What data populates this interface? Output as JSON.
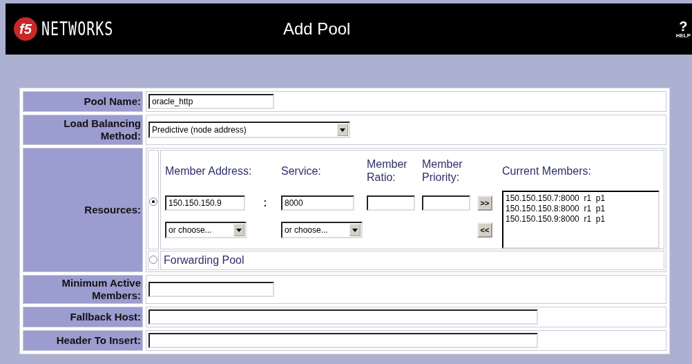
{
  "header": {
    "logo_mark": "f5",
    "logo_text": "NETWORKS",
    "title": "Add Pool",
    "help_mark": "?",
    "help_label": "HELP"
  },
  "rows": [
    {
      "kind": "text",
      "label": "Pool Name:",
      "value": "oracle_http"
    },
    {
      "kind": "select",
      "label": "Load Balancing Method:",
      "value": "Predictive (node address)"
    },
    {
      "kind": "resources",
      "label": "Resources:",
      "options": [
        {
          "kind": "members",
          "selected": true,
          "address_label": "Member Address:",
          "service_label": "Service:",
          "ratio_label": "Member Ratio:",
          "priority_label": "Member Priority:",
          "current_label": "Current Members:",
          "address": "150.150.150.9",
          "separator": ":",
          "service": "8000",
          "address_choose": "or choose...",
          "service_choose": "or choose...",
          "add_button": ">>",
          "remove_button": "<<",
          "members": [
            "150.150.150.7:8000  r1  p1",
            "150.150.150.8:8000  r1  p1",
            "150.150.150.9:8000  r1  p1"
          ]
        },
        {
          "kind": "forwarding",
          "selected": false,
          "label": "Forwarding Pool"
        }
      ]
    },
    {
      "kind": "text",
      "label": "Minimum Active Members:",
      "value": ""
    },
    {
      "kind": "wide_text",
      "label": "Fallback Host:",
      "value": ""
    },
    {
      "kind": "wide_text",
      "label": "Header To Insert:",
      "value": ""
    }
  ]
}
